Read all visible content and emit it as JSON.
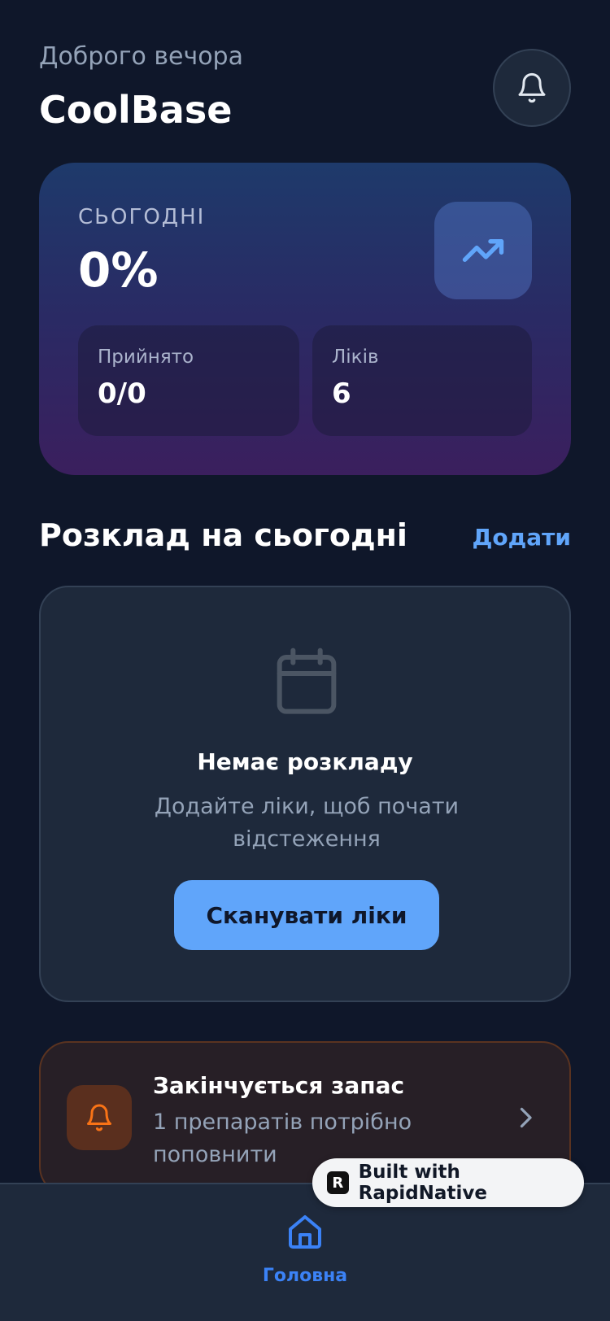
{
  "header": {
    "greeting": "Доброго вечора",
    "app_name": "CoolBase",
    "notifications_icon": "bell-icon"
  },
  "stats": {
    "today_label": "СЬОГОДНІ",
    "today_value": "0%",
    "trend_icon": "trending-up-icon",
    "taken_label": "Прийнято",
    "taken_value": "0/0",
    "meds_label": "Ліків",
    "meds_value": "6"
  },
  "schedule": {
    "title": "Розклад на сьогодні",
    "add_label": "Додати",
    "empty_icon": "calendar-icon",
    "empty_title": "Немає розкладу",
    "empty_desc": "Додайте ліки, щоб почати відстеження",
    "scan_label": "Сканувати ліки"
  },
  "low_stock": {
    "icon": "bell-icon",
    "title": "Закінчується запас",
    "desc": "1 препаратів потрібно поповнити"
  },
  "tabbar": {
    "home_label": "Головна"
  },
  "badge": {
    "logo": "R",
    "text": "Built with RapidNative"
  },
  "colors": {
    "background": "#0f172a",
    "card": "#1e293b",
    "accent": "#60a5fa",
    "warning": "#f97316"
  }
}
